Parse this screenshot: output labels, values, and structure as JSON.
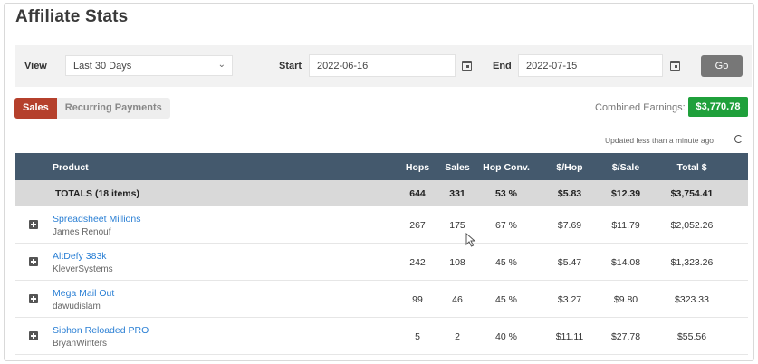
{
  "page": {
    "title": "Affiliate Stats"
  },
  "filters": {
    "view_label": "View",
    "view_value": "Last 30 Days",
    "start_label": "Start",
    "start_value": "2022-06-16",
    "end_label": "End",
    "end_value": "2022-07-15",
    "go_label": "Go"
  },
  "tabs": [
    {
      "label": "Sales",
      "active": true
    },
    {
      "label": "Recurring Payments",
      "active": false
    }
  ],
  "earnings": {
    "label": "Combined Earnings:",
    "value": "$3,770.78"
  },
  "updated_text": "Updated less than a minute ago",
  "table": {
    "headers": [
      "Product",
      "Hops",
      "Sales",
      "Hop Conv.",
      "$/Hop",
      "$/Sale",
      "Total $"
    ],
    "totals": {
      "label": "TOTALS (18 items)",
      "hops": "644",
      "sales": "331",
      "conv": "53 %",
      "per_hop": "$5.83",
      "per_sale": "$12.39",
      "total": "$3,754.41"
    },
    "rows": [
      {
        "product": "Spreadsheet Millions",
        "vendor": "James Renouf",
        "hops": "267",
        "sales": "175",
        "conv": "67 %",
        "per_hop": "$7.69",
        "per_sale": "$11.79",
        "total": "$2,052.26"
      },
      {
        "product": "AltDefy 383k",
        "vendor": "KleverSystems",
        "hops": "242",
        "sales": "108",
        "conv": "45 %",
        "per_hop": "$5.47",
        "per_sale": "$14.08",
        "total": "$1,323.26"
      },
      {
        "product": "Mega Mail Out",
        "vendor": "dawudislam",
        "hops": "99",
        "sales": "46",
        "conv": "45 %",
        "per_hop": "$3.27",
        "per_sale": "$9.80",
        "total": "$323.33"
      },
      {
        "product": "Siphon Reloaded PRO",
        "vendor": "BryanWinters",
        "hops": "5",
        "sales": "2",
        "conv": "40 %",
        "per_hop": "$11.11",
        "per_sale": "$27.78",
        "total": "$55.56"
      }
    ]
  },
  "colors": {
    "header_bg": "#44596d",
    "active_tab": "#b5402c",
    "earnings_badge": "#1fa03b",
    "link": "#2a7fd4"
  }
}
